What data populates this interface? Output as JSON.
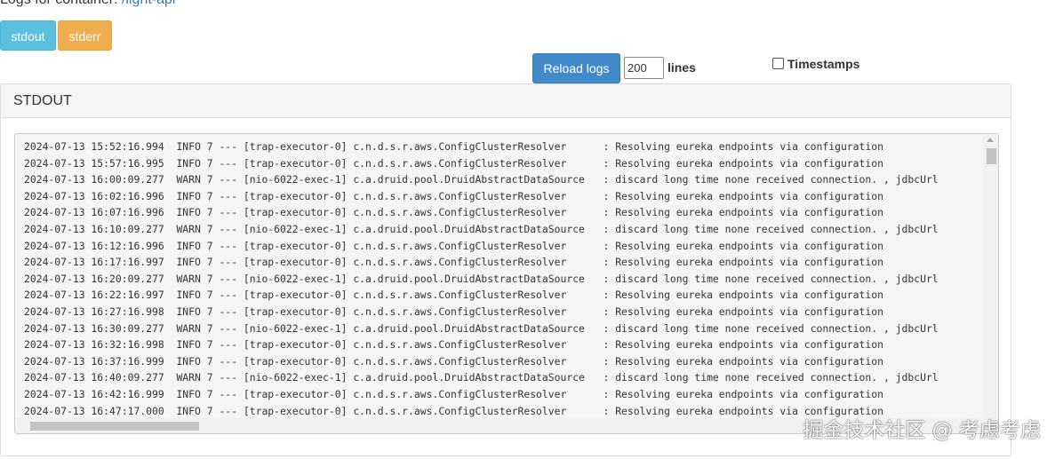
{
  "header": {
    "label": "Logs for container:",
    "container_link": "/light-api"
  },
  "stream_tabs": {
    "stdout_label": "stdout",
    "stderr_label": "stderr"
  },
  "controls": {
    "reload_label": "Reload logs",
    "lines_value": "200",
    "lines_label": "lines",
    "timestamps_label": "Timestamps",
    "timestamps_checked": false
  },
  "panel": {
    "title": "STDOUT",
    "log_lines": [
      "2024-07-13 15:52:16.994  INFO 7 --- [trap-executor-0] c.n.d.s.r.aws.ConfigClusterResolver      : Resolving eureka endpoints via configuration",
      "2024-07-13 15:57:16.995  INFO 7 --- [trap-executor-0] c.n.d.s.r.aws.ConfigClusterResolver      : Resolving eureka endpoints via configuration",
      "2024-07-13 16:00:09.277  WARN 7 --- [nio-6022-exec-1] c.a.druid.pool.DruidAbstractDataSource   : discard long time none received connection. , jdbcUrl",
      "2024-07-13 16:02:16.996  INFO 7 --- [trap-executor-0] c.n.d.s.r.aws.ConfigClusterResolver      : Resolving eureka endpoints via configuration",
      "2024-07-13 16:07:16.996  INFO 7 --- [trap-executor-0] c.n.d.s.r.aws.ConfigClusterResolver      : Resolving eureka endpoints via configuration",
      "2024-07-13 16:10:09.277  WARN 7 --- [nio-6022-exec-1] c.a.druid.pool.DruidAbstractDataSource   : discard long time none received connection. , jdbcUrl",
      "2024-07-13 16:12:16.996  INFO 7 --- [trap-executor-0] c.n.d.s.r.aws.ConfigClusterResolver      : Resolving eureka endpoints via configuration",
      "2024-07-13 16:17:16.997  INFO 7 --- [trap-executor-0] c.n.d.s.r.aws.ConfigClusterResolver      : Resolving eureka endpoints via configuration",
      "2024-07-13 16:20:09.277  WARN 7 --- [nio-6022-exec-1] c.a.druid.pool.DruidAbstractDataSource   : discard long time none received connection. , jdbcUrl",
      "2024-07-13 16:22:16.997  INFO 7 --- [trap-executor-0] c.n.d.s.r.aws.ConfigClusterResolver      : Resolving eureka endpoints via configuration",
      "2024-07-13 16:27:16.998  INFO 7 --- [trap-executor-0] c.n.d.s.r.aws.ConfigClusterResolver      : Resolving eureka endpoints via configuration",
      "2024-07-13 16:30:09.277  WARN 7 --- [nio-6022-exec-1] c.a.druid.pool.DruidAbstractDataSource   : discard long time none received connection. , jdbcUrl",
      "2024-07-13 16:32:16.998  INFO 7 --- [trap-executor-0] c.n.d.s.r.aws.ConfigClusterResolver      : Resolving eureka endpoints via configuration",
      "2024-07-13 16:37:16.999  INFO 7 --- [trap-executor-0] c.n.d.s.r.aws.ConfigClusterResolver      : Resolving eureka endpoints via configuration",
      "2024-07-13 16:40:09.277  WARN 7 --- [nio-6022-exec-1] c.a.druid.pool.DruidAbstractDataSource   : discard long time none received connection. , jdbcUrl",
      "2024-07-13 16:42:16.999  INFO 7 --- [trap-executor-0] c.n.d.s.r.aws.ConfigClusterResolver      : Resolving eureka endpoints via configuration",
      "2024-07-13 16:47:17.000  INFO 7 --- [trap-executor-0] c.n.d.s.r.aws.ConfigClusterResolver      : Resolving eureka endpoints via configuration"
    ]
  },
  "watermark": "掘金技术社区 @ 考虑考虑",
  "colors": {
    "stdout_button": "#5bc0de",
    "stderr_button": "#f0ad4e",
    "reload_button": "#428bca",
    "link": "#337ab7",
    "log_background": "#f5f5f5"
  }
}
